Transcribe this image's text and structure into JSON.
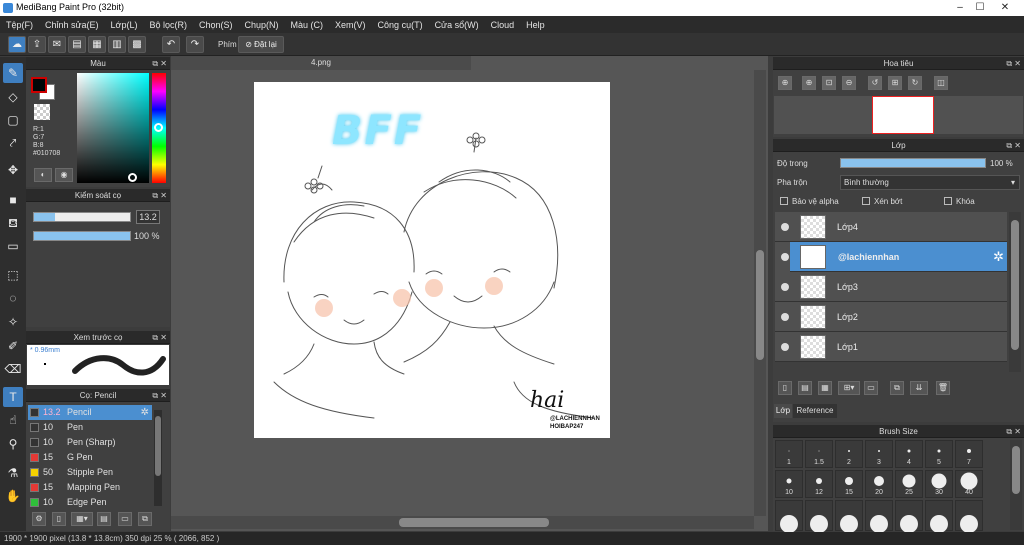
{
  "window": {
    "title": "MediBang Paint Pro (32bit)"
  },
  "menu": [
    "Tệp(F)",
    "Chỉnh sửa(E)",
    "Lớp(L)",
    "Bộ lọc(R)",
    "Chọn(S)",
    "Chụp(N)",
    "Màu (C)",
    "Xem(V)",
    "Công cụ(T)",
    "Cửa sổ(W)",
    "Cloud",
    "Help"
  ],
  "toolbar": {
    "key_label": "Phím",
    "reset_label": "Đặt lại"
  },
  "color_panel": {
    "title": "Màu",
    "r": "R:1",
    "g": "G:7",
    "b": "B:8",
    "hex": "#010708"
  },
  "size_panel": {
    "title": "Kiểm soát cọ",
    "size_value": "13.2",
    "opacity_value": "100 %",
    "size_fraction": 0.22,
    "opacity_fraction": 1.0
  },
  "preview_panel": {
    "title": "Xem trước cọ",
    "size": "0.96mm"
  },
  "brush_panel": {
    "title": "Cọ: Pencil",
    "items": [
      {
        "size": "13.2",
        "name": "Pencil",
        "color": "#333333",
        "selected": true
      },
      {
        "size": "10",
        "name": "Pen",
        "color": "#333333"
      },
      {
        "size": "10",
        "name": "Pen (Sharp)",
        "color": "#333333"
      },
      {
        "size": "15",
        "name": "G Pen",
        "color": "#e53935"
      },
      {
        "size": "50",
        "name": "Stipple Pen",
        "color": "#f5d100"
      },
      {
        "size": "15",
        "name": "Mapping Pen",
        "color": "#e53935"
      },
      {
        "size": "10",
        "name": "Edge Pen",
        "color": "#2fbf3a"
      }
    ]
  },
  "document": {
    "tab": "4.png",
    "art_title": "BFF",
    "signature": "hai",
    "credit1": "@LACHIENNHAN",
    "credit2": "HOIBAP247"
  },
  "navigator": {
    "title": "Hoa tiêu"
  },
  "layer_panel": {
    "title": "Lớp",
    "opacity_label": "Độ trong",
    "opacity_value": "100 %",
    "opacity_fraction": 1.0,
    "blend_label": "Pha trộn",
    "blend_value": "Bình thường",
    "alpha_label": "Bảo vệ alpha",
    "clip_label": "Xén bớt",
    "lock_label": "Khóa",
    "layers": [
      "Lớp4",
      "@lachiennhan",
      "Lớp3",
      "Lớp2",
      "Lớp1"
    ],
    "tabs": [
      "Lớp",
      "Reference"
    ]
  },
  "brush_size_panel": {
    "title": "Brush Size",
    "row1": [
      "1",
      "1.5",
      "2",
      "3",
      "4",
      "5",
      "7"
    ],
    "row2": [
      "10",
      "12",
      "15",
      "20",
      "25",
      "30",
      "40"
    ]
  },
  "status": "1900 * 1900 pixel   (13.8 * 13.8cm)   350 dpi   25 %   ( 2066, 852 )"
}
